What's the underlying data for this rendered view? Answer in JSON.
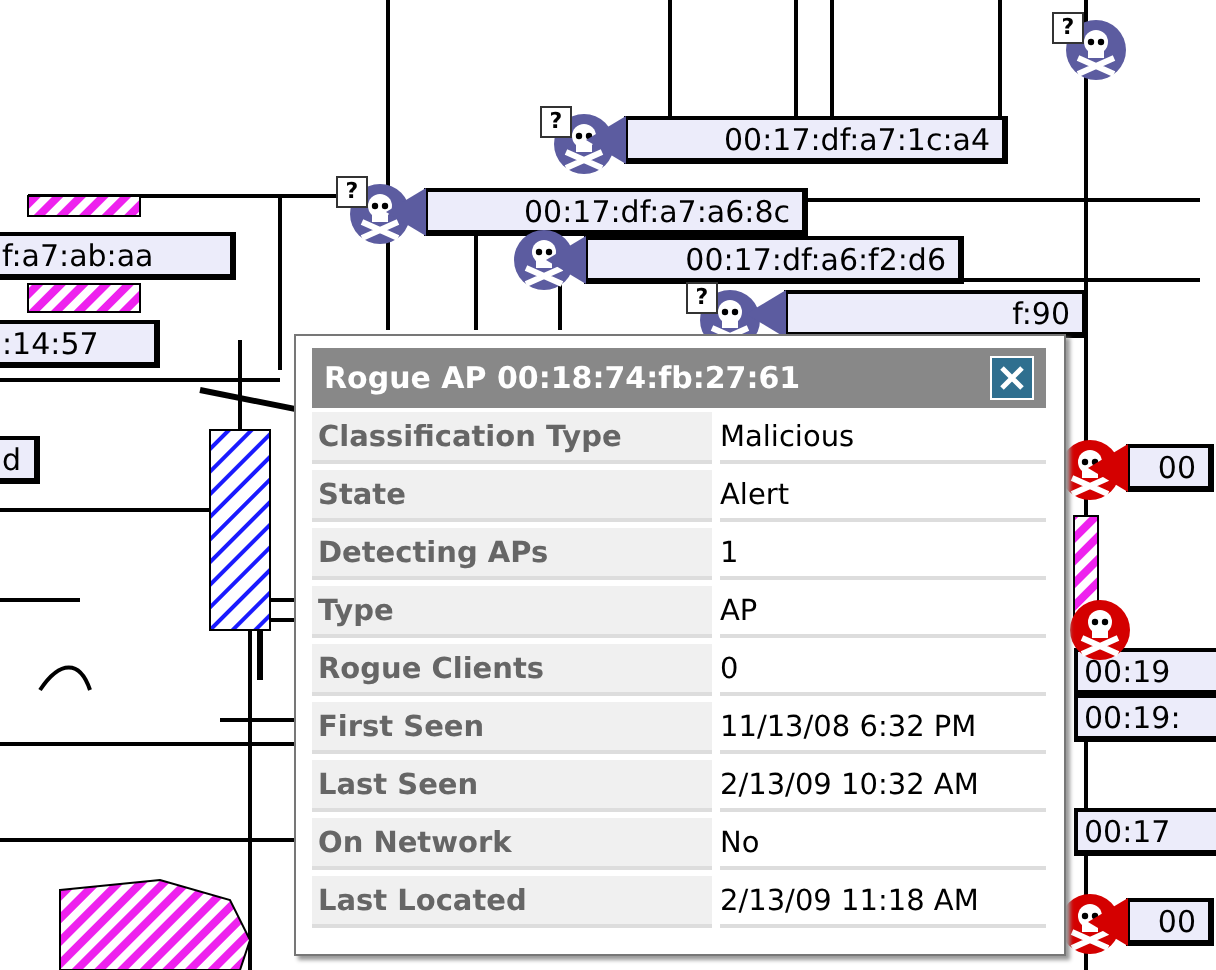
{
  "map": {
    "markers": [
      {
        "badge": "?",
        "color": "#5c5ca0"
      },
      {
        "badge": "?",
        "color": "#5c5ca0",
        "label": "00:17:df:a7:1c:a4"
      },
      {
        "badge": "?",
        "color": "#5c5ca0",
        "label": "00:17:df:a7:a6:8c"
      },
      {
        "color": "#5c5ca0",
        "label": "00:17:df:a6:f2:d6"
      },
      {
        "badge": "?",
        "color": "#5c5ca0",
        "label": "f:90"
      },
      {
        "color": "#d40000",
        "label": "00"
      },
      {
        "color": "#d40000"
      },
      {
        "color": "#d40000",
        "label": "00"
      }
    ],
    "tags": [
      "f:a7:ab:aa",
      ":14:57",
      "d",
      "00:19",
      "00:19:",
      "00:17"
    ]
  },
  "popup": {
    "title": "Rogue AP 00:18:74:fb:27:61",
    "rows": [
      {
        "label": "Classification Type",
        "value": "Malicious"
      },
      {
        "label": "State",
        "value": "Alert"
      },
      {
        "label": "Detecting APs",
        "value": "1"
      },
      {
        "label": "Type",
        "value": "AP"
      },
      {
        "label": "Rogue Clients",
        "value": "0"
      },
      {
        "label": "First Seen",
        "value": "11/13/08 6:32 PM"
      },
      {
        "label": "Last Seen",
        "value": "2/13/09 10:32 AM"
      },
      {
        "label": "On Network",
        "value": "No"
      },
      {
        "label": "Last Located",
        "value": "2/13/09 11:18 AM"
      }
    ]
  }
}
